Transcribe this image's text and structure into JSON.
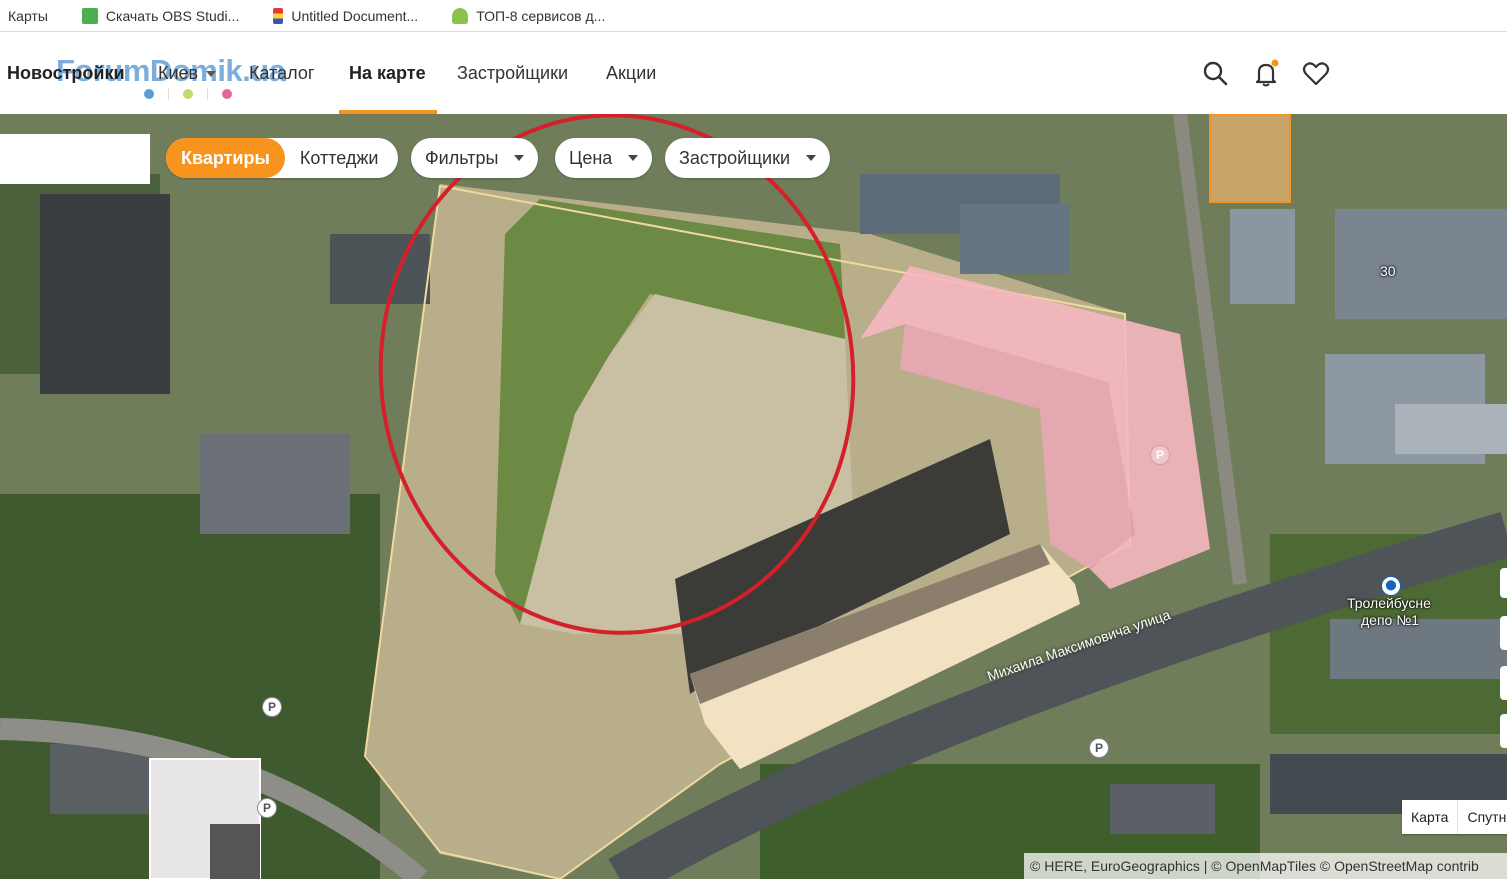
{
  "bookmarks": [
    {
      "label": "Карты",
      "icon": "maps-icon",
      "color": "#d32f2f"
    },
    {
      "label": "Скачать OBS Studi...",
      "icon": "download-icon",
      "color": "#4caf50"
    },
    {
      "label": "Untitled Document...",
      "icon": "document-icon",
      "color": "#3f51b5"
    },
    {
      "label": "ТОП-8 сервисов д...",
      "icon": "leaf-icon",
      "color": "#8bc34a"
    }
  ],
  "header": {
    "logo_watermark": "ForumDomik.ua",
    "nav": {
      "novostroyki": "Новостройки",
      "city": "Киев",
      "catalog": "Каталог",
      "on_map": "На карте",
      "developers": "Застройщики",
      "promos": "Акции"
    },
    "accent_color": "#f7941d"
  },
  "filters": {
    "apartments": "Квартиры",
    "cottages": "Коттеджи",
    "filters": "Фильтры",
    "price": "Цена",
    "developers": "Застройщики",
    "active": "Квартиры"
  },
  "map": {
    "building_number": "30",
    "depot_label_1": "Тролейбусне",
    "depot_label_2": "депо №1",
    "street_name": "Михаила Максимовича улица",
    "parking_label": "P",
    "map_type_map": "Карта",
    "map_type_sat": "Спутн",
    "attribution": "© HERE, EuroGeographics | © OpenMapTiles © OpenStreetMap contrib"
  }
}
